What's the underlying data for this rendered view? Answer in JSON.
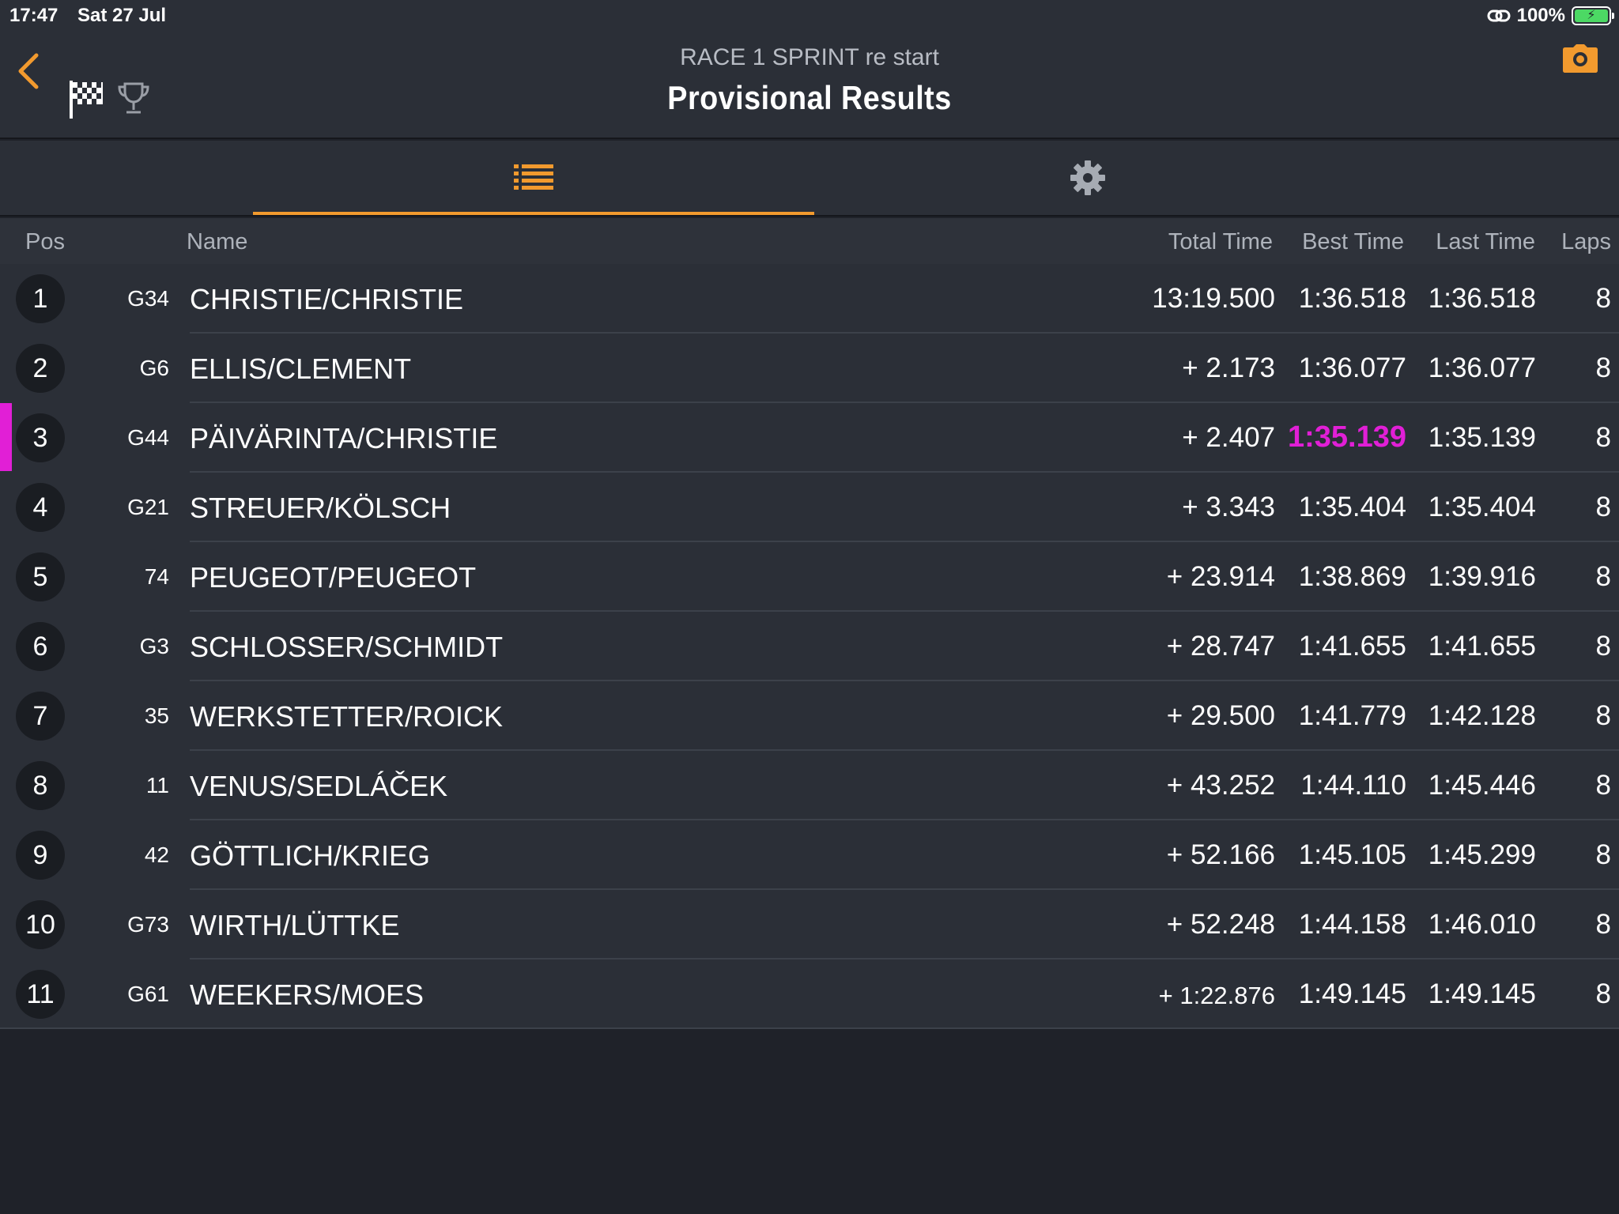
{
  "status_bar": {
    "time": "17:47",
    "date": "Sat 27 Jul",
    "battery": "100%"
  },
  "header": {
    "subtitle": "RACE 1 SPRINT re start",
    "title": "Provisional Results"
  },
  "icons": {
    "back": "chevron-left-icon",
    "flag": "checkered-flag-icon",
    "trophy": "trophy-icon",
    "camera": "camera-icon",
    "list": "list-icon",
    "settings": "gear-icon",
    "link": "link-icon",
    "battery": "battery-charging-icon"
  },
  "colors": {
    "accent": "#f29a2e",
    "fastest": "#e11fd6",
    "background": "#1f2229",
    "row": "#2b2f37"
  },
  "table": {
    "columns": {
      "pos": "Pos",
      "name": "Name",
      "total": "Total Time",
      "best": "Best Time",
      "last": "Last Time",
      "laps": "Laps"
    },
    "rows": [
      {
        "pos": "1",
        "car": "G34",
        "name": "CHRISTIE/CHRISTIE",
        "total": "13:19.500",
        "best": "1:36.518",
        "last": "1:36.518",
        "laps": "8"
      },
      {
        "pos": "2",
        "car": "G6",
        "name": "ELLIS/CLEMENT",
        "total": "+ 2.173",
        "best": "1:36.077",
        "last": "1:36.077",
        "laps": "8"
      },
      {
        "pos": "3",
        "car": "G44",
        "name": "PÄIVÄRINTA/CHRISTIE",
        "total": "+ 2.407",
        "best": "1:35.139",
        "last": "1:35.139",
        "laps": "8"
      },
      {
        "pos": "4",
        "car": "G21",
        "name": "STREUER/KÖLSCH",
        "total": "+ 3.343",
        "best": "1:35.404",
        "last": "1:35.404",
        "laps": "8"
      },
      {
        "pos": "5",
        "car": "74",
        "name": "PEUGEOT/PEUGEOT",
        "total": "+ 23.914",
        "best": "1:38.869",
        "last": "1:39.916",
        "laps": "8"
      },
      {
        "pos": "6",
        "car": "G3",
        "name": "SCHLOSSER/SCHMIDT",
        "total": "+ 28.747",
        "best": "1:41.655",
        "last": "1:41.655",
        "laps": "8"
      },
      {
        "pos": "7",
        "car": "35",
        "name": "WERKSTETTER/ROICK",
        "total": "+ 29.500",
        "best": "1:41.779",
        "last": "1:42.128",
        "laps": "8"
      },
      {
        "pos": "8",
        "car": "11",
        "name": "VENUS/SEDLÁČEK",
        "total": "+ 43.252",
        "best": "1:44.110",
        "last": "1:45.446",
        "laps": "8"
      },
      {
        "pos": "9",
        "car": "42",
        "name": "GÖTTLICH/KRIEG",
        "total": "+ 52.166",
        "best": "1:45.105",
        "last": "1:45.299",
        "laps": "8"
      },
      {
        "pos": "10",
        "car": "G73",
        "name": "WIRTH/LÜTTKE",
        "total": "+ 52.248",
        "best": "1:44.158",
        "last": "1:46.010",
        "laps": "8"
      },
      {
        "pos": "11",
        "car": "G61",
        "name": "WEEKERS/MOES",
        "total": "+ 1:22.876",
        "best": "1:49.145",
        "last": "1:49.145",
        "laps": "8"
      }
    ]
  }
}
